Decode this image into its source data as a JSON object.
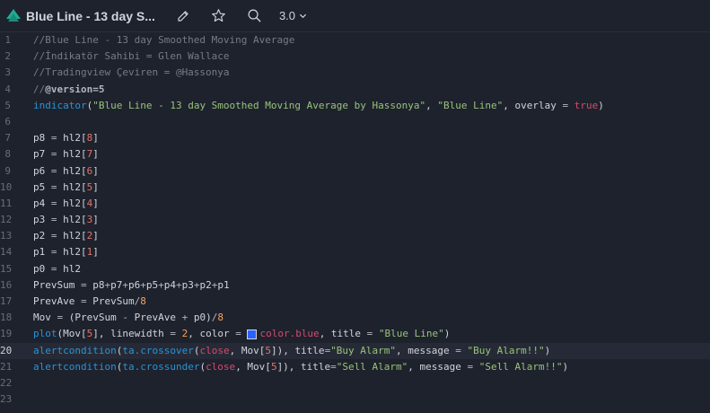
{
  "header": {
    "title": "Blue Line - 13 day S...",
    "version": "3.0",
    "icons": [
      "logo-icon",
      "pencil-icon",
      "star-icon",
      "search-icon",
      "chevron-down-icon"
    ]
  },
  "editor": {
    "active_line": 20,
    "line_numbers": [
      "1",
      "2",
      "3",
      "4",
      "5",
      "6",
      "7",
      "8",
      "9",
      "10",
      "11",
      "12",
      "13",
      "14",
      "15",
      "16",
      "17",
      "18",
      "19",
      "20",
      "21",
      "22",
      "23"
    ],
    "lines": [
      [
        {
          "t": "//Blue Line - 13 day Smoothed Moving Average",
          "c": "cm"
        }
      ],
      [
        {
          "t": "//İndikatör Sahibi = Glen Wallace",
          "c": "cm"
        }
      ],
      [
        {
          "t": "//Tradingview Çeviren = @Hassonya",
          "c": "cm"
        }
      ],
      [
        {
          "t": "//",
          "c": "cm"
        },
        {
          "t": "@version=5",
          "c": "vr"
        }
      ],
      [
        {
          "t": "indicator",
          "c": "fn"
        },
        {
          "t": "(",
          "c": "id"
        },
        {
          "t": "\"Blue Line - 13 day Smoothed Moving Average by Hassonya\"",
          "c": "str"
        },
        {
          "t": ", ",
          "c": "id"
        },
        {
          "t": "\"Blue Line\"",
          "c": "str"
        },
        {
          "t": ", overlay ",
          "c": "id"
        },
        {
          "t": "=",
          "c": "op"
        },
        {
          "t": " ",
          "c": "id"
        },
        {
          "t": "true",
          "c": "kw"
        },
        {
          "t": ")",
          "c": "id"
        }
      ],
      [],
      [
        {
          "t": "p8 ",
          "c": "id"
        },
        {
          "t": "=",
          "c": "op"
        },
        {
          "t": " hl2[",
          "c": "id"
        },
        {
          "t": "8",
          "c": "arr"
        },
        {
          "t": "]",
          "c": "id"
        }
      ],
      [
        {
          "t": "p7 ",
          "c": "id"
        },
        {
          "t": "=",
          "c": "op"
        },
        {
          "t": " hl2[",
          "c": "id"
        },
        {
          "t": "7",
          "c": "arr"
        },
        {
          "t": "]",
          "c": "id"
        }
      ],
      [
        {
          "t": "p6 ",
          "c": "id"
        },
        {
          "t": "=",
          "c": "op"
        },
        {
          "t": " hl2[",
          "c": "id"
        },
        {
          "t": "6",
          "c": "arr"
        },
        {
          "t": "]",
          "c": "id"
        }
      ],
      [
        {
          "t": "p5 ",
          "c": "id"
        },
        {
          "t": "=",
          "c": "op"
        },
        {
          "t": " hl2[",
          "c": "id"
        },
        {
          "t": "5",
          "c": "arr"
        },
        {
          "t": "]",
          "c": "id"
        }
      ],
      [
        {
          "t": "p4 ",
          "c": "id"
        },
        {
          "t": "=",
          "c": "op"
        },
        {
          "t": " hl2[",
          "c": "id"
        },
        {
          "t": "4",
          "c": "arr"
        },
        {
          "t": "]",
          "c": "id"
        }
      ],
      [
        {
          "t": "p3 ",
          "c": "id"
        },
        {
          "t": "=",
          "c": "op"
        },
        {
          "t": " hl2[",
          "c": "id"
        },
        {
          "t": "3",
          "c": "arr"
        },
        {
          "t": "]",
          "c": "id"
        }
      ],
      [
        {
          "t": "p2 ",
          "c": "id"
        },
        {
          "t": "=",
          "c": "op"
        },
        {
          "t": " hl2[",
          "c": "id"
        },
        {
          "t": "2",
          "c": "arr"
        },
        {
          "t": "]",
          "c": "id"
        }
      ],
      [
        {
          "t": "p1 ",
          "c": "id"
        },
        {
          "t": "=",
          "c": "op"
        },
        {
          "t": " hl2[",
          "c": "id"
        },
        {
          "t": "1",
          "c": "arr"
        },
        {
          "t": "]",
          "c": "id"
        }
      ],
      [
        {
          "t": "p0 ",
          "c": "id"
        },
        {
          "t": "=",
          "c": "op"
        },
        {
          "t": " hl2",
          "c": "id"
        }
      ],
      [
        {
          "t": "PrevSum ",
          "c": "id"
        },
        {
          "t": "=",
          "c": "op"
        },
        {
          "t": " p8",
          "c": "id"
        },
        {
          "t": "+",
          "c": "op"
        },
        {
          "t": "p7",
          "c": "id"
        },
        {
          "t": "+",
          "c": "op"
        },
        {
          "t": "p6",
          "c": "id"
        },
        {
          "t": "+",
          "c": "op"
        },
        {
          "t": "p5",
          "c": "id"
        },
        {
          "t": "+",
          "c": "op"
        },
        {
          "t": "p4",
          "c": "id"
        },
        {
          "t": "+",
          "c": "op"
        },
        {
          "t": "p3",
          "c": "id"
        },
        {
          "t": "+",
          "c": "op"
        },
        {
          "t": "p2",
          "c": "id"
        },
        {
          "t": "+",
          "c": "op"
        },
        {
          "t": "p1",
          "c": "id"
        }
      ],
      [
        {
          "t": "PrevAve ",
          "c": "id"
        },
        {
          "t": "=",
          "c": "op"
        },
        {
          "t": " PrevSum",
          "c": "id"
        },
        {
          "t": "/",
          "c": "op"
        },
        {
          "t": "8",
          "c": "num"
        }
      ],
      [
        {
          "t": "Mov ",
          "c": "id"
        },
        {
          "t": "=",
          "c": "op"
        },
        {
          "t": " (PrevSum ",
          "c": "id"
        },
        {
          "t": "-",
          "c": "op"
        },
        {
          "t": " PrevAve ",
          "c": "id"
        },
        {
          "t": "+",
          "c": "op"
        },
        {
          "t": " p0)",
          "c": "id"
        },
        {
          "t": "/",
          "c": "op"
        },
        {
          "t": "8",
          "c": "num"
        }
      ],
      [
        {
          "t": "plot",
          "c": "fn"
        },
        {
          "t": "(Mov[",
          "c": "id"
        },
        {
          "t": "5",
          "c": "arr"
        },
        {
          "t": "], linewidth ",
          "c": "id"
        },
        {
          "t": "=",
          "c": "op"
        },
        {
          "t": " ",
          "c": "id"
        },
        {
          "t": "2",
          "c": "num"
        },
        {
          "t": ", color ",
          "c": "id"
        },
        {
          "t": "=",
          "c": "op"
        },
        {
          "t": " ",
          "c": "id"
        },
        {
          "t": "",
          "c": "swatch"
        },
        {
          "t": "color.blue",
          "c": "kw"
        },
        {
          "t": ", title ",
          "c": "id"
        },
        {
          "t": "=",
          "c": "op"
        },
        {
          "t": " ",
          "c": "id"
        },
        {
          "t": "\"Blue Line\"",
          "c": "str"
        },
        {
          "t": ")",
          "c": "id"
        }
      ],
      [
        {
          "t": "alertcondition",
          "c": "fn"
        },
        {
          "t": "(",
          "c": "id"
        },
        {
          "t": "ta.crossover",
          "c": "fn"
        },
        {
          "t": "(",
          "c": "id"
        },
        {
          "t": "close",
          "c": "kw"
        },
        {
          "t": ", Mov[",
          "c": "id"
        },
        {
          "t": "5",
          "c": "arr"
        },
        {
          "t": "]), title",
          "c": "id"
        },
        {
          "t": "=",
          "c": "op"
        },
        {
          "t": "\"Buy Alarm\"",
          "c": "str"
        },
        {
          "t": ", message ",
          "c": "id"
        },
        {
          "t": "=",
          "c": "op"
        },
        {
          "t": " ",
          "c": "id"
        },
        {
          "t": "\"Buy Alarm!!\"",
          "c": "str"
        },
        {
          "t": ")",
          "c": "id"
        }
      ],
      [
        {
          "t": "alertcondition",
          "c": "fn"
        },
        {
          "t": "(",
          "c": "id"
        },
        {
          "t": "ta.crossunder",
          "c": "fn"
        },
        {
          "t": "(",
          "c": "id"
        },
        {
          "t": "close",
          "c": "kw"
        },
        {
          "t": ", Mov[",
          "c": "id"
        },
        {
          "t": "5",
          "c": "arr"
        },
        {
          "t": "]), title",
          "c": "id"
        },
        {
          "t": "=",
          "c": "op"
        },
        {
          "t": "\"Sell Alarm\"",
          "c": "str"
        },
        {
          "t": ", message ",
          "c": "id"
        },
        {
          "t": "=",
          "c": "op"
        },
        {
          "t": " ",
          "c": "id"
        },
        {
          "t": "\"Sell Alarm!!\"",
          "c": "str"
        },
        {
          "t": ")",
          "c": "id"
        }
      ],
      [],
      []
    ]
  },
  "colors": {
    "background": "#1e222d",
    "accent_logo": "#22ab94",
    "swatch": "#2962ff"
  }
}
